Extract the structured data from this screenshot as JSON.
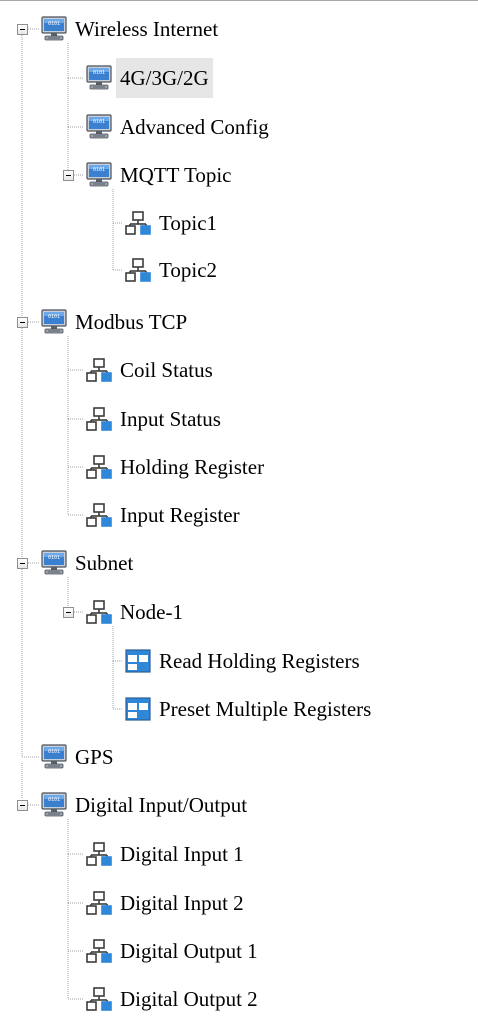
{
  "tree": {
    "nodes": [
      {
        "id": "wireless-internet",
        "label": "Wireless Internet",
        "icon": "computer-icon",
        "expanded": true
      },
      {
        "id": "4g3g2g",
        "label": "4G/3G/2G",
        "icon": "computer-icon",
        "selected": true
      },
      {
        "id": "advanced-config",
        "label": "Advanced Config",
        "icon": "computer-icon"
      },
      {
        "id": "mqtt-topic",
        "label": "MQTT Topic",
        "icon": "computer-icon",
        "expanded": true
      },
      {
        "id": "topic1",
        "label": "Topic1",
        "icon": "network-icon"
      },
      {
        "id": "topic2",
        "label": "Topic2",
        "icon": "network-icon"
      },
      {
        "id": "modbus-tcp",
        "label": "Modbus TCP",
        "icon": "computer-icon",
        "expanded": true
      },
      {
        "id": "coil-status",
        "label": "Coil Status",
        "icon": "network-icon"
      },
      {
        "id": "input-status",
        "label": "Input Status",
        "icon": "network-icon"
      },
      {
        "id": "holding-register",
        "label": "Holding Register",
        "icon": "network-icon"
      },
      {
        "id": "input-register",
        "label": "Input Register",
        "icon": "network-icon"
      },
      {
        "id": "subnet",
        "label": "Subnet",
        "icon": "computer-icon",
        "expanded": true
      },
      {
        "id": "node-1",
        "label": "Node-1",
        "icon": "network-icon",
        "expanded": true
      },
      {
        "id": "read-holding-registers",
        "label": "Read Holding Registers",
        "icon": "table-icon"
      },
      {
        "id": "preset-multiple-registers",
        "label": "Preset Multiple Registers",
        "icon": "table-icon"
      },
      {
        "id": "gps",
        "label": "GPS",
        "icon": "computer-icon"
      },
      {
        "id": "digital-io",
        "label": "Digital Input/Output",
        "icon": "computer-icon",
        "expanded": true
      },
      {
        "id": "digital-input-1",
        "label": "Digital Input 1",
        "icon": "network-icon"
      },
      {
        "id": "digital-input-2",
        "label": "Digital Input 2",
        "icon": "network-icon"
      },
      {
        "id": "digital-output-1",
        "label": "Digital Output 1",
        "icon": "network-icon"
      },
      {
        "id": "digital-output-2",
        "label": "Digital Output 2",
        "icon": "network-icon"
      }
    ]
  },
  "colors": {
    "connector_dots": "#a0a0a0",
    "selection_bg": "#e6e6e6",
    "icon_blue": "#2f87d8",
    "icon_dark": "#3c3c3c"
  }
}
